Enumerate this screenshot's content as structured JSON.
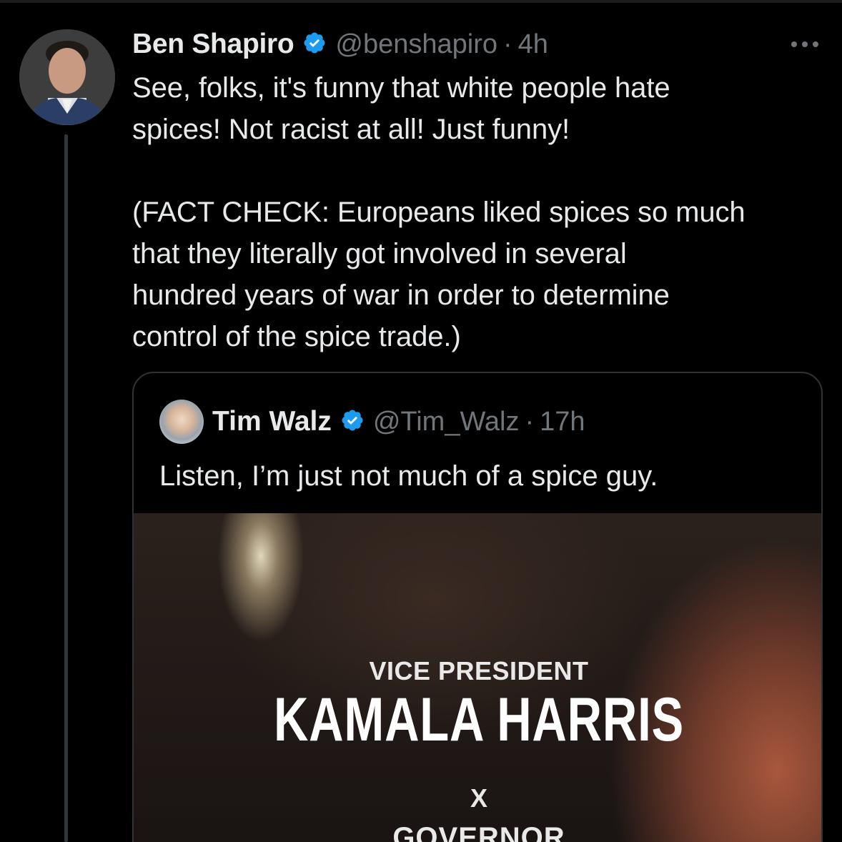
{
  "tweet": {
    "author_name": "Ben Shapiro",
    "handle": "@benshapiro",
    "separator": "·",
    "time": "4h",
    "more_icon": "more-horizontal-icon",
    "text": "See, folks, it's funny that white people hate\nspices! Not racist at all! Just funny!\n\n(FACT CHECK: Europeans liked spices so much\nthat they literally got involved in several\nhundred years of war in order to determine\ncontrol of the spice trade.)"
  },
  "quoted": {
    "author_name": "Tim Walz",
    "handle": "@Tim_Walz",
    "separator": "·",
    "time": "17h",
    "text": "Listen, I’m just not much of a spice guy.",
    "media": {
      "kicker": "VICE PRESIDENT",
      "title": "KAMALA HARRIS",
      "x": "X",
      "next_line": "GOVERNOR"
    }
  },
  "colors": {
    "background": "#000000",
    "text_primary": "#e7e9ea",
    "text_secondary": "#71767b",
    "verified": "#1d9bf0",
    "border": "#2f3336"
  }
}
